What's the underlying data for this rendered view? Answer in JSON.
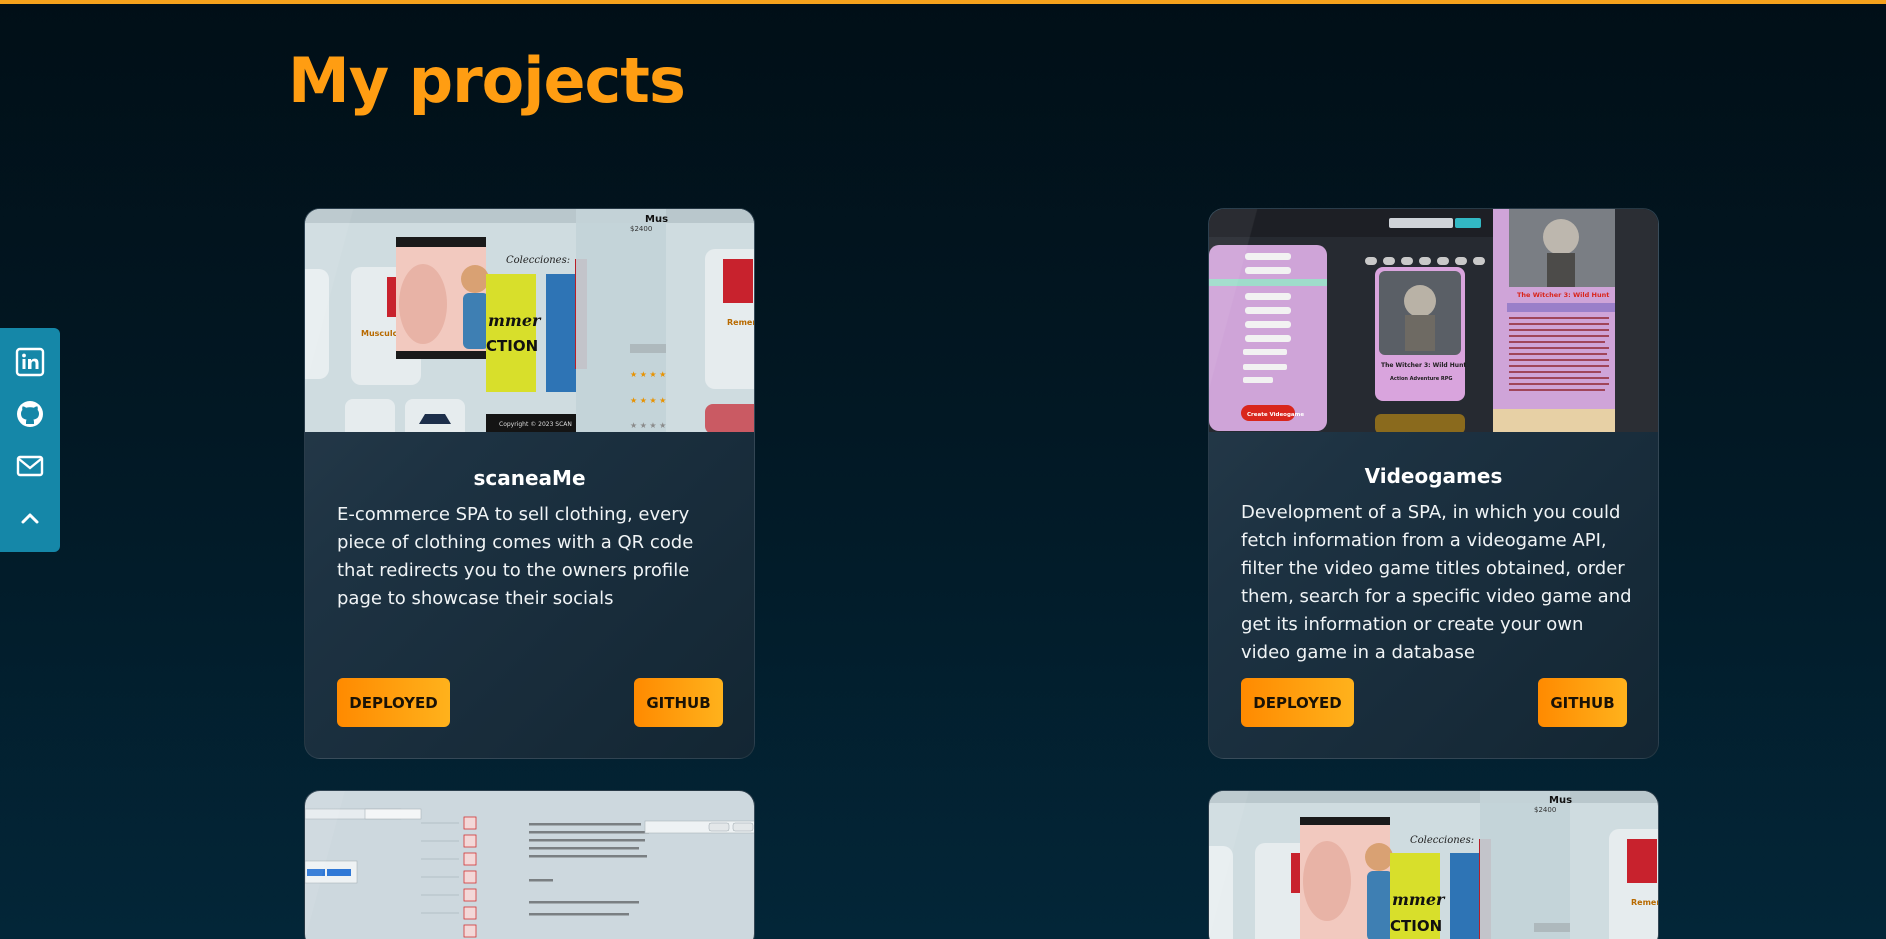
{
  "page": {
    "title": "My projects",
    "accent_color": "#ff9d12"
  },
  "social": {
    "items": [
      {
        "icon": "linkedin-icon"
      },
      {
        "icon": "github-icon"
      },
      {
        "icon": "mail-icon"
      },
      {
        "icon": "chevron-up-icon"
      }
    ]
  },
  "projects": [
    {
      "title": "scaneaMe",
      "description": "E-commerce SPA to sell clothing, every piece of clothing comes with a QR code that redirects you to the owners profile page to showcase their socials",
      "deployed_label": "DEPLOYED",
      "github_label": "GITHUB",
      "thumb": {
        "colecciones": "Colecciones:",
        "mus": "Mus",
        "price": "$2400",
        "summer": "mmer",
        "ction": "CTION",
        "copyright": "Copyright © 2023 SCAN"
      }
    },
    {
      "title": "Videogames",
      "description": "Development of a SPA, in which you could fetch information from a videogame API, filter the video game titles obtained, order them, search for a specific video game and get its information or create your own video game in a database",
      "deployed_label": "DEPLOYED",
      "github_label": "GITHUB",
      "thumb": {
        "game_title": "The Witcher 3: Wild Hunt",
        "genres": "Action Adventure RPG",
        "create_btn": "Create Videogame"
      }
    }
  ]
}
